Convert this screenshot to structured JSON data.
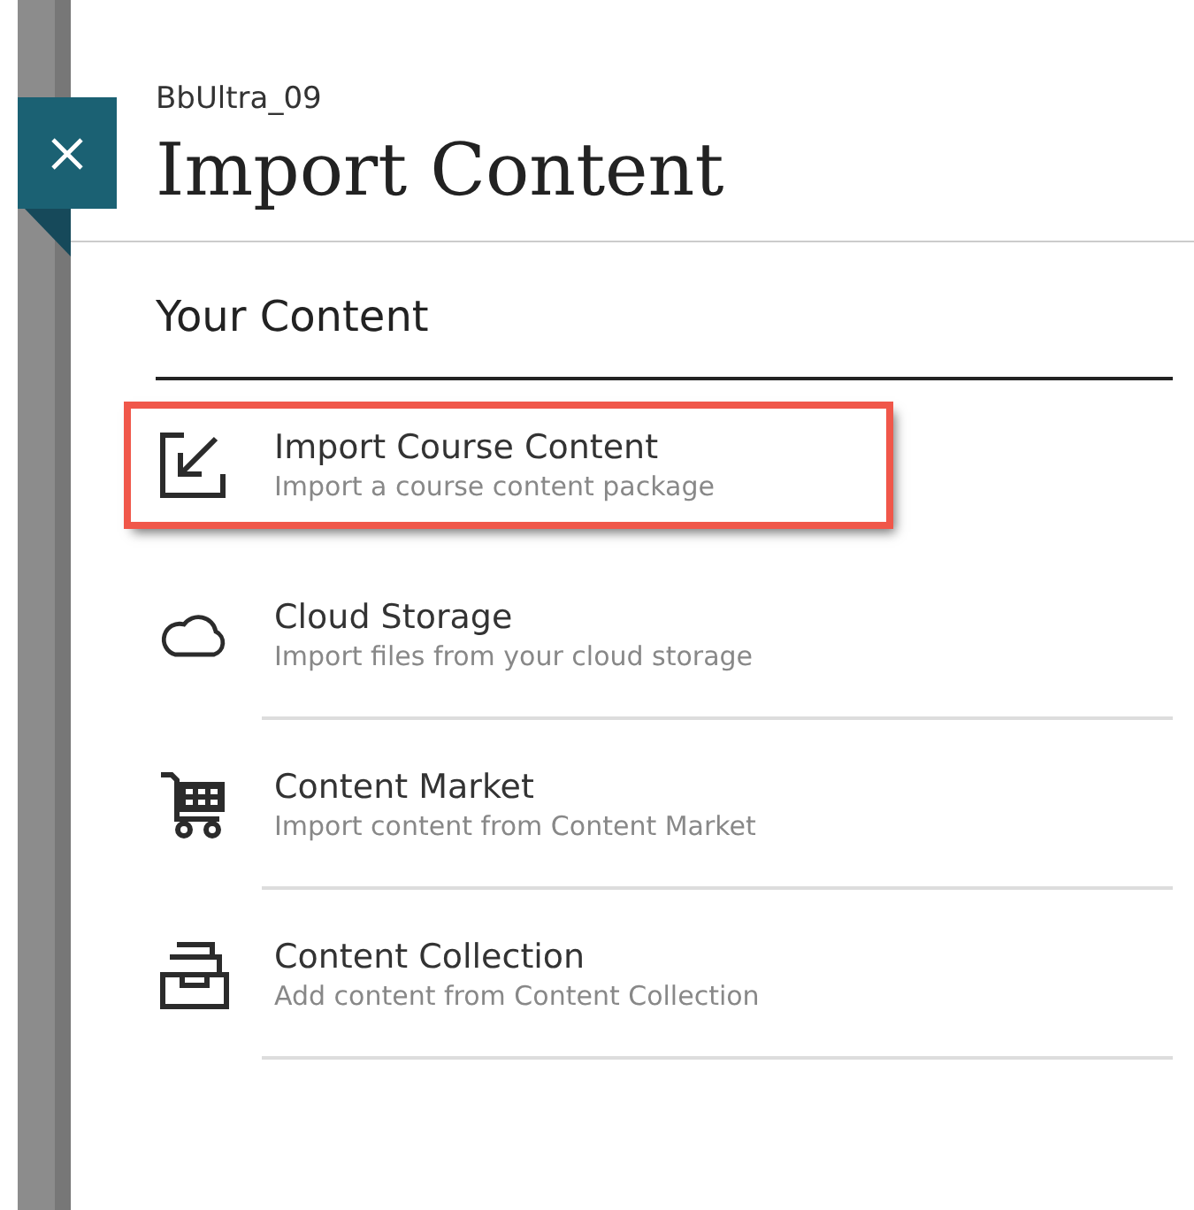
{
  "header": {
    "course": "BbUltra_09",
    "title": "Import Content"
  },
  "section": {
    "title": "Your Content"
  },
  "items": [
    {
      "kind": "import",
      "title": "Import Course Content",
      "subtitle": "Import a course content package",
      "highlighted": true
    },
    {
      "kind": "cloud",
      "title": "Cloud Storage",
      "subtitle": "Import files from your cloud storage",
      "highlighted": false
    },
    {
      "kind": "cart",
      "title": "Content Market",
      "subtitle": "Import content from Content Market",
      "highlighted": false
    },
    {
      "kind": "tray",
      "title": "Content Collection",
      "subtitle": "Add content from Content Collection",
      "highlighted": false
    }
  ]
}
